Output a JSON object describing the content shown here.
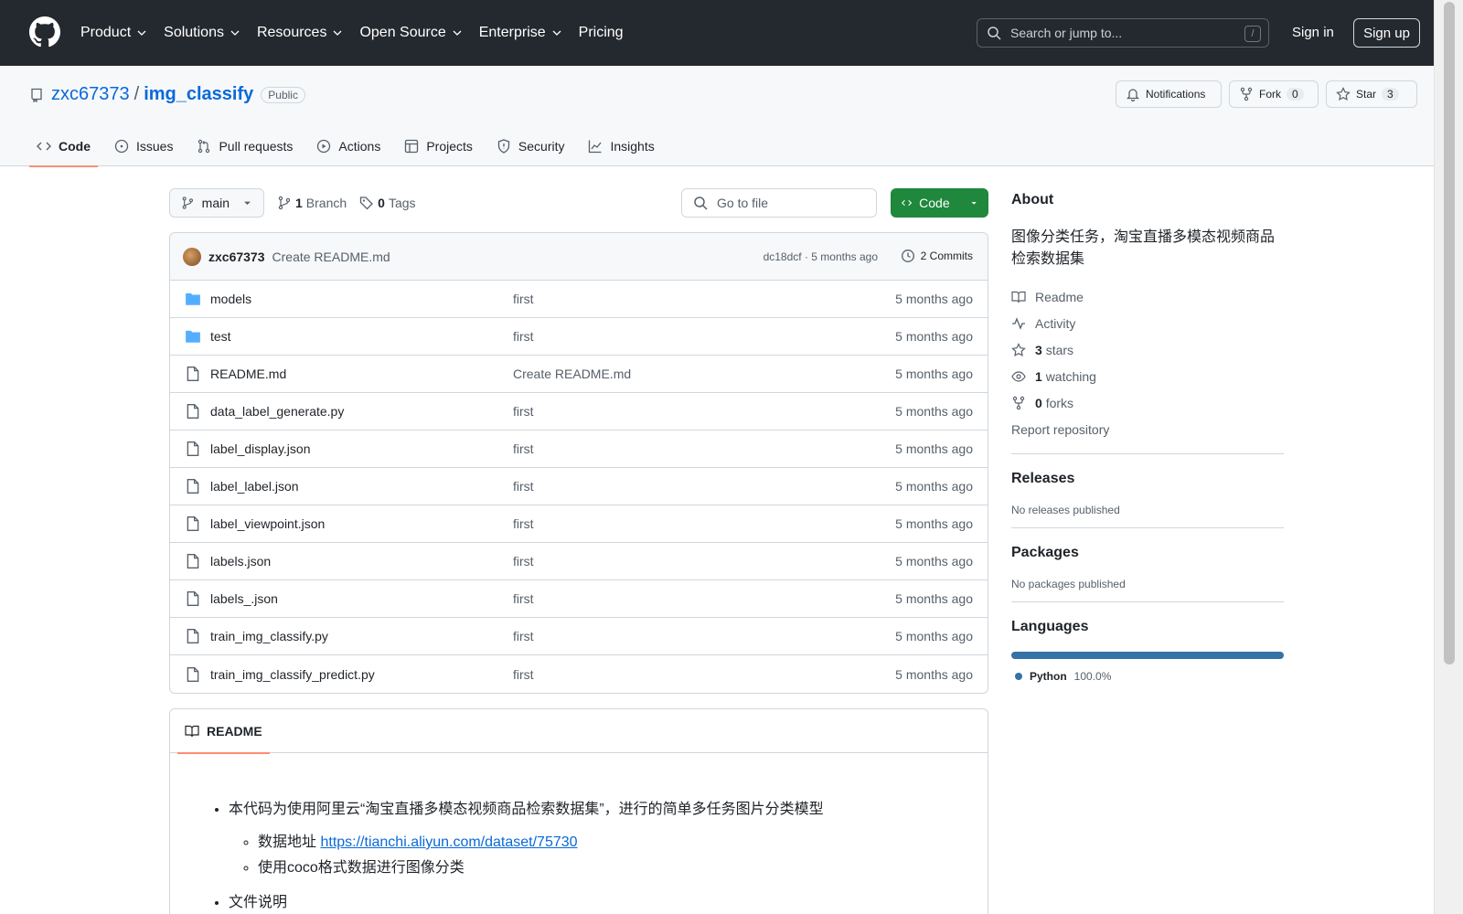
{
  "header": {
    "nav": [
      "Product",
      "Solutions",
      "Resources",
      "Open Source",
      "Enterprise",
      "Pricing"
    ],
    "search_placeholder": "Search or jump to...",
    "search_shortcut": "/",
    "sign_in": "Sign in",
    "sign_up": "Sign up"
  },
  "repo": {
    "owner": "zxc67373",
    "separator": "/",
    "name": "img_classify",
    "visibility": "Public",
    "notifications_label": "Notifications",
    "fork_label": "Fork",
    "fork_count": "0",
    "star_label": "Star",
    "star_count": "3",
    "tabs": [
      "Code",
      "Issues",
      "Pull requests",
      "Actions",
      "Projects",
      "Security",
      "Insights"
    ]
  },
  "toolbar": {
    "branch": "main",
    "branch_count": "1",
    "branch_label": "Branch",
    "tag_count": "0",
    "tag_label": "Tags",
    "goto_placeholder": "Go to file",
    "code_label": "Code"
  },
  "commit": {
    "author": "zxc67373",
    "message": "Create README.md",
    "meta": "dc18dcf · 5 months ago",
    "commits": "2 Commits"
  },
  "files": [
    {
      "name": "models",
      "type": "dir",
      "msg": "first",
      "age": "5 months ago"
    },
    {
      "name": "test",
      "type": "dir",
      "msg": "first",
      "age": "5 months ago"
    },
    {
      "name": "README.md",
      "type": "file",
      "msg": "Create README.md",
      "age": "5 months ago"
    },
    {
      "name": "data_label_generate.py",
      "type": "file",
      "msg": "first",
      "age": "5 months ago"
    },
    {
      "name": "label_display.json",
      "type": "file",
      "msg": "first",
      "age": "5 months ago"
    },
    {
      "name": "label_label.json",
      "type": "file",
      "msg": "first",
      "age": "5 months ago"
    },
    {
      "name": "label_viewpoint.json",
      "type": "file",
      "msg": "first",
      "age": "5 months ago"
    },
    {
      "name": "labels.json",
      "type": "file",
      "msg": "first",
      "age": "5 months ago"
    },
    {
      "name": "labels_.json",
      "type": "file",
      "msg": "first",
      "age": "5 months ago"
    },
    {
      "name": "train_img_classify.py",
      "type": "file",
      "msg": "first",
      "age": "5 months ago"
    },
    {
      "name": "train_img_classify_predict.py",
      "type": "file",
      "msg": "first",
      "age": "5 months ago"
    }
  ],
  "readme": {
    "tab": "README",
    "item1": "本代码为使用阿里云“淘宝直播多模态视频商品检索数据集”，进行的简单多任务图片分类模型",
    "sub1_prefix": "数据地址",
    "sub1_link": "https://tianchi.aliyun.com/dataset/75730",
    "sub2": "使用coco格式数据进行图像分类",
    "item2": "文件说明"
  },
  "sidebar": {
    "about_title": "About",
    "description": "图像分类任务，淘宝直播多模态视频商品检索数据集",
    "readme": "Readme",
    "activity": "Activity",
    "stars_count": "3",
    "stars_label": "stars",
    "watching_count": "1",
    "watching_label": "watching",
    "forks_count": "0",
    "forks_label": "forks",
    "report": "Report repository",
    "releases_title": "Releases",
    "releases_empty": "No releases published",
    "packages_title": "Packages",
    "packages_empty": "No packages published",
    "languages_title": "Languages",
    "language_name": "Python",
    "language_pct": "100.0%",
    "language_color": "#3572A5"
  }
}
